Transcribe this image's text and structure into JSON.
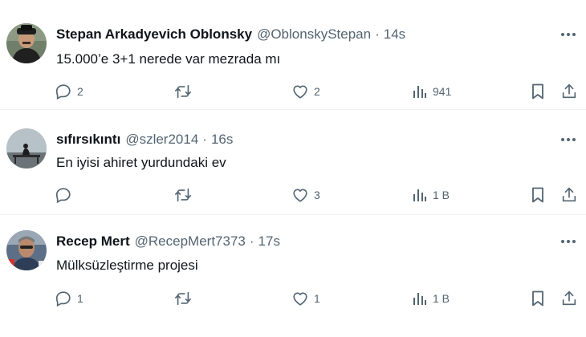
{
  "tweets": [
    {
      "name": "Stepan Arkadyevich Oblonsky",
      "handle": "@OblonskyStepan",
      "separator": "·",
      "time": "14s",
      "text": "15.000’e 3+1 nerede var mezrada mı",
      "replies": "2",
      "retweets": "",
      "likes": "2",
      "views": "941"
    },
    {
      "name": "sıfırsıkıntı",
      "handle": "@szler2014",
      "separator": "·",
      "time": "16s",
      "text": "En iyisi ahiret yurdundaki  ev",
      "replies": "",
      "retweets": "",
      "likes": "3",
      "views": "1 B"
    },
    {
      "name": "Recep Mert",
      "handle": "@RecepMert7373",
      "separator": "·",
      "time": "17s",
      "text": "Mülksüzleştirme projesi",
      "replies": "1",
      "retweets": "",
      "likes": "1",
      "views": "1 B"
    }
  ],
  "colors": {
    "text": "#0f1419",
    "secondary": "#536471",
    "divider": "#eff3f4"
  },
  "icons": [
    "reply-icon",
    "retweet-icon",
    "like-icon",
    "views-icon",
    "bookmark-icon",
    "share-icon",
    "more-icon"
  ]
}
